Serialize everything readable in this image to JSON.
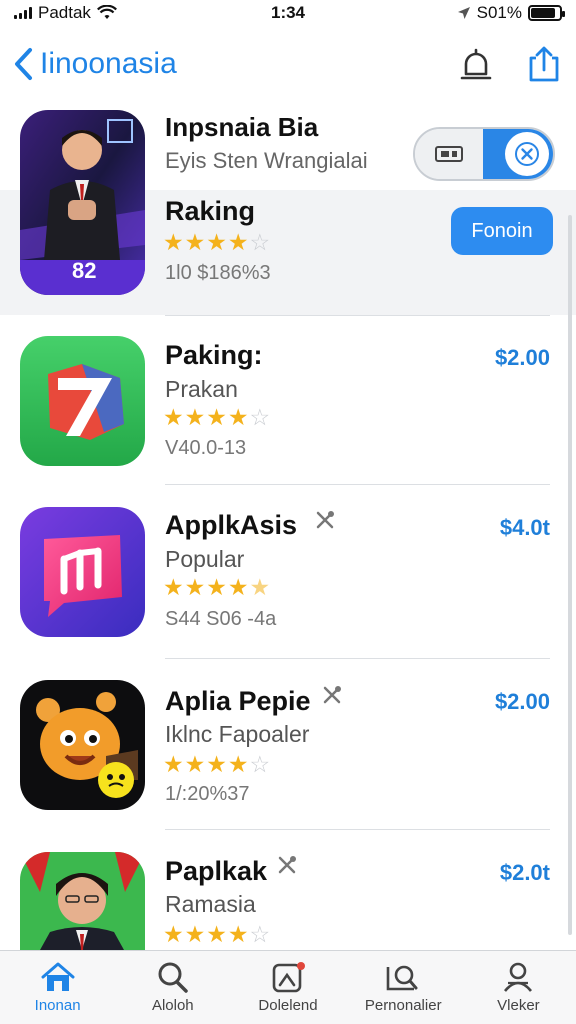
{
  "status_bar": {
    "carrier": "Padtak",
    "time": "1:34",
    "battery": "S01%",
    "battery_level": 0.85
  },
  "nav": {
    "back_label": "Iinoonasia",
    "icons": [
      "bell-icon",
      "share-icon"
    ]
  },
  "featured": {
    "title": "Inpsnaia Bia",
    "subtitle": "Eyis Sten Wrangialai",
    "toggle_state": "on"
  },
  "apps": [
    {
      "title": "Raking",
      "rating": 4,
      "meta": "1l0 $186%3",
      "action_label": "Fonoin",
      "icon": "person-portrait-icon",
      "icon_label": "82"
    },
    {
      "title": "Paking:",
      "subtitle": "Prakan",
      "rating": 4,
      "meta": "V40.0-13",
      "price": "$2.00",
      "icon": "lightning-seven-icon"
    },
    {
      "title": "ApplkAsis",
      "subtitle": "Popular",
      "rating": 4.5,
      "meta": "S44 S06 -4a",
      "price": "$4.0t",
      "icon": "music-note-icon",
      "badge": "tools-icon"
    },
    {
      "title": "Aplia Pepie",
      "subtitle": "Iklnc Fapoaler",
      "rating": 4,
      "meta": "1/:20%37",
      "price": "$2.00",
      "icon": "cartoon-creature-icon",
      "badge": "tools-icon"
    },
    {
      "title": "Paplkak",
      "subtitle": "Ramasia",
      "rating": 4,
      "price": "$2.0t",
      "icon": "person-portrait-icon",
      "badge": "tools-icon"
    }
  ],
  "tabs": [
    {
      "label": "Inonan",
      "icon": "home-icon",
      "active": true
    },
    {
      "label": "Aloloh",
      "icon": "search-icon",
      "active": false
    },
    {
      "label": "Dolelend",
      "icon": "games-icon",
      "active": false
    },
    {
      "label": "Pernonalier",
      "icon": "apps-search-icon",
      "active": false
    },
    {
      "label": "Vleker",
      "icon": "profile-icon",
      "active": false
    }
  ],
  "colors": {
    "accent": "#1f84e6",
    "star": "#f4b21c",
    "price": "#1f7fd9"
  }
}
